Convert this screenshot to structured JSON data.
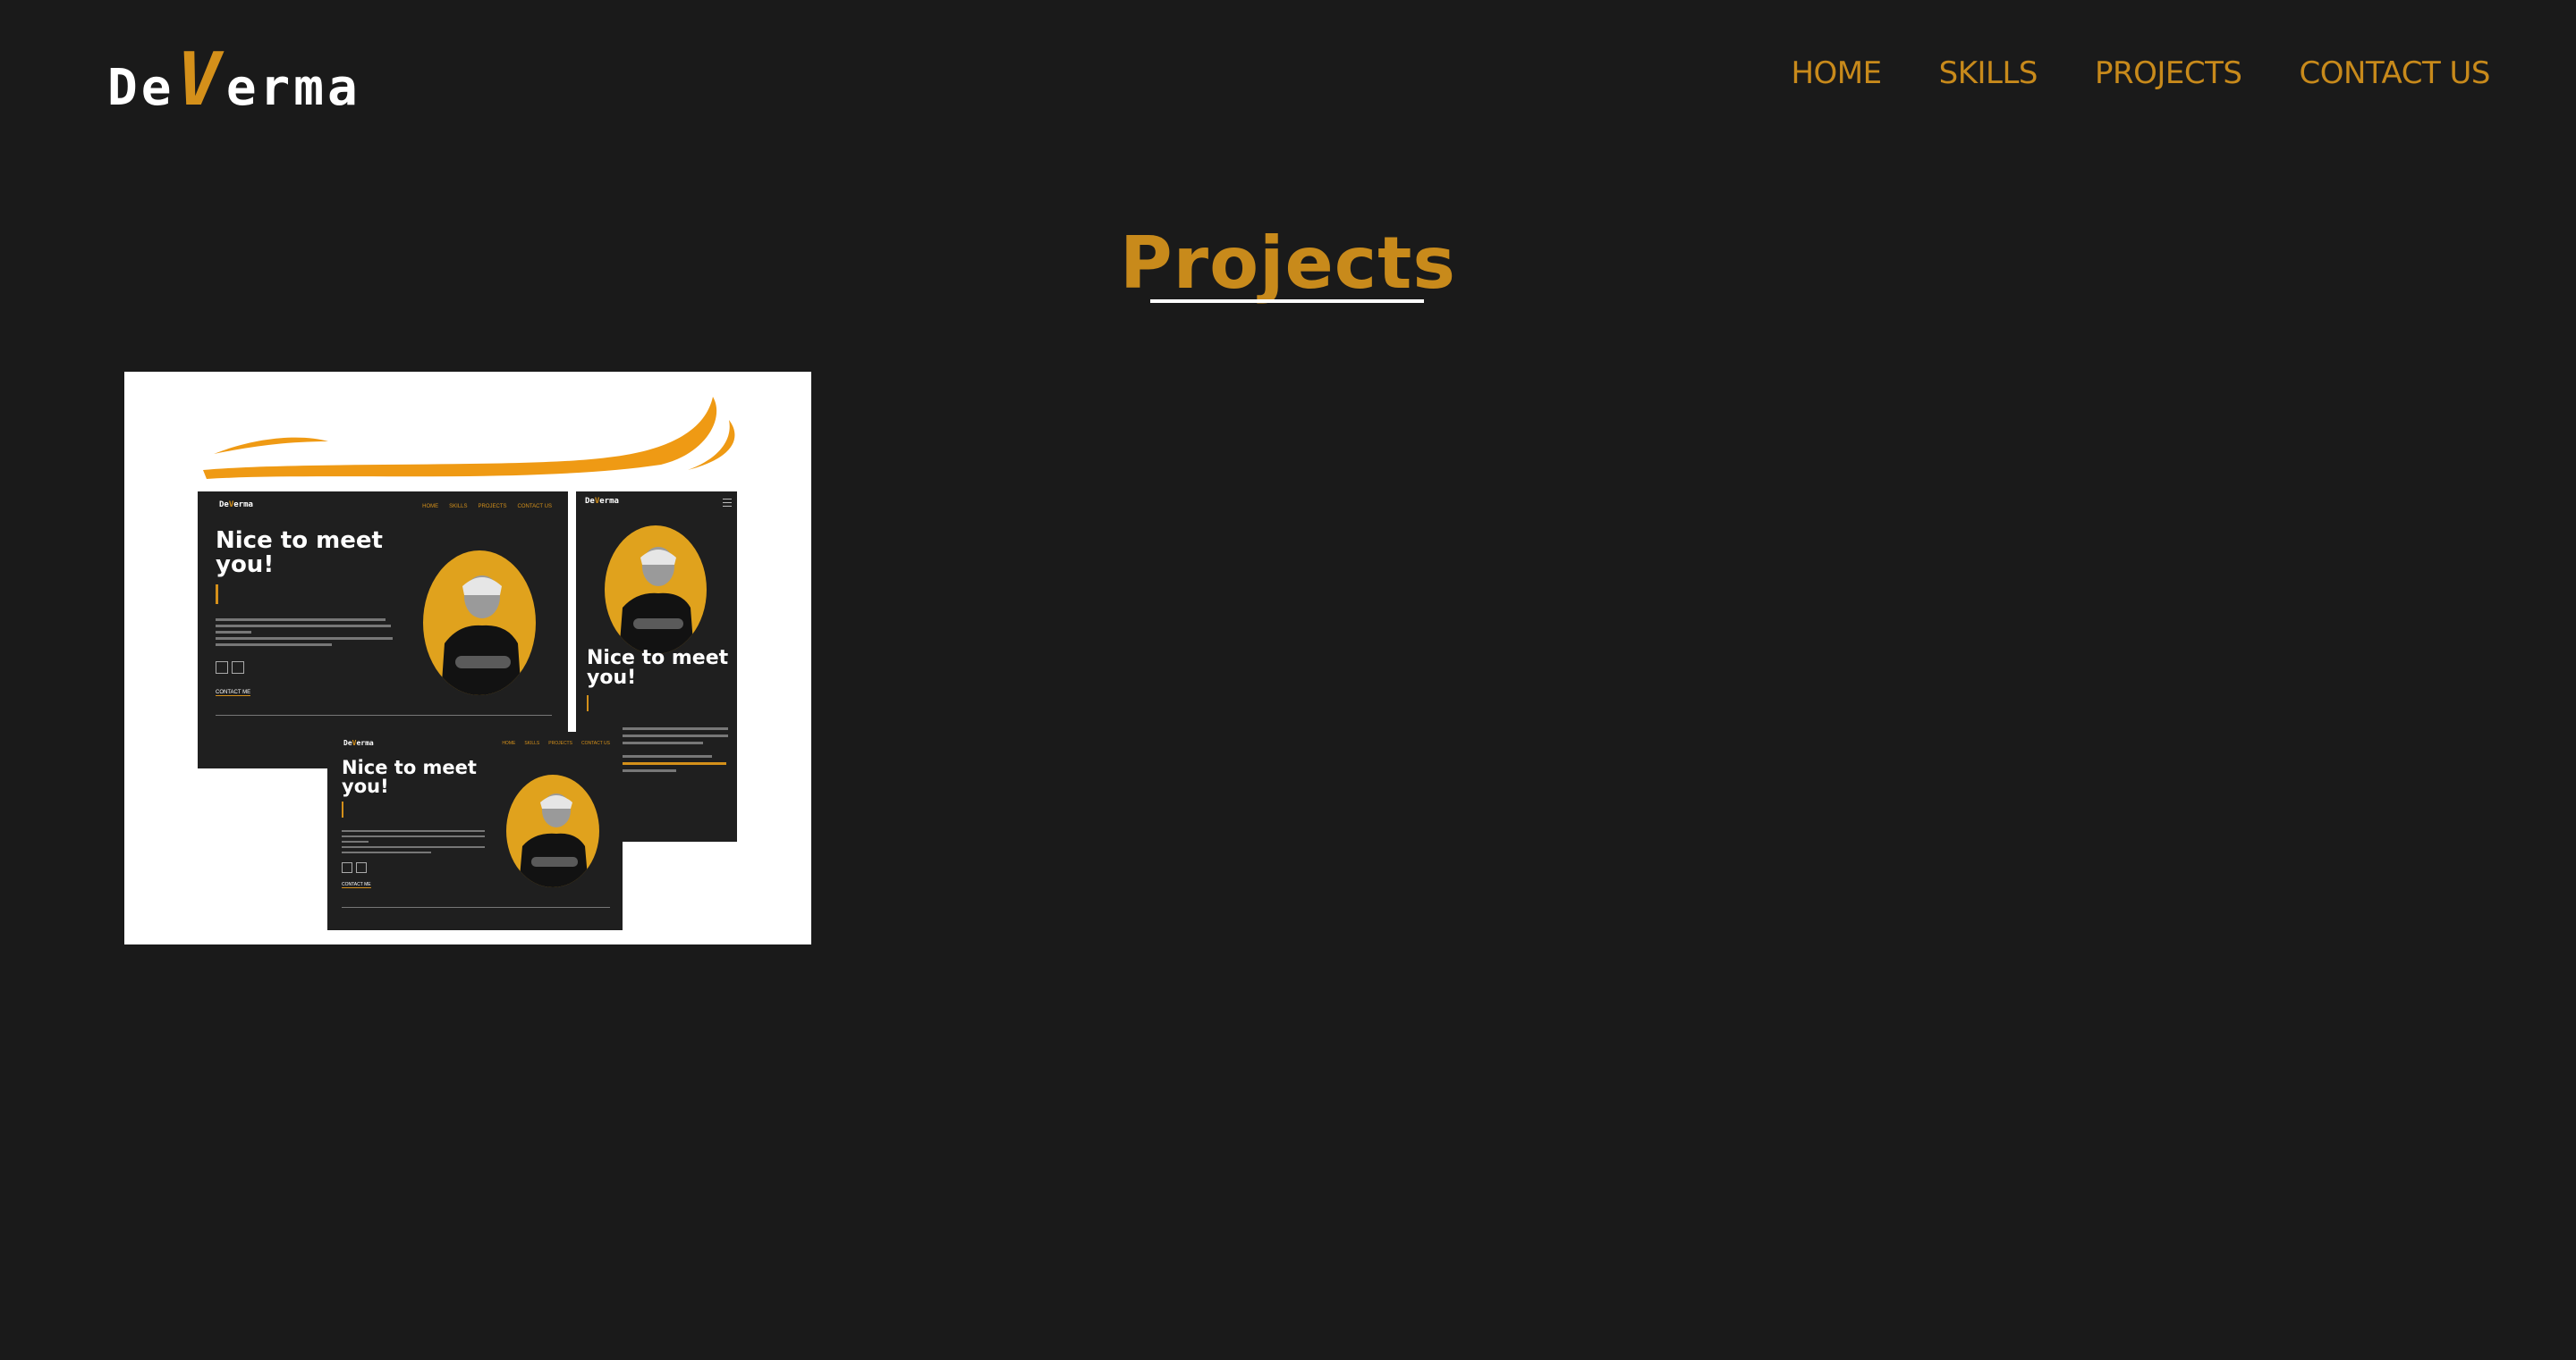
{
  "header": {
    "logo": {
      "part1": "De",
      "accent": "V",
      "part2": "erma"
    },
    "nav": [
      {
        "label": "HOME"
      },
      {
        "label": "SKILLS"
      },
      {
        "label": "PROJECTS"
      },
      {
        "label": "CONTACT US"
      }
    ]
  },
  "main": {
    "title": "Projects",
    "project": {
      "mockup": {
        "logo": {
          "part1": "De",
          "accent": "V",
          "part2": "erma"
        },
        "nav": [
          "HOME",
          "SKILLS",
          "PROJECTS",
          "CONTACT US"
        ],
        "heading": "Nice to meet you!",
        "contact_link": "CONTACT ME"
      }
    }
  },
  "colors": {
    "background": "#1a1a1a",
    "accent": "#c88a1b",
    "card": "#ffffff"
  }
}
